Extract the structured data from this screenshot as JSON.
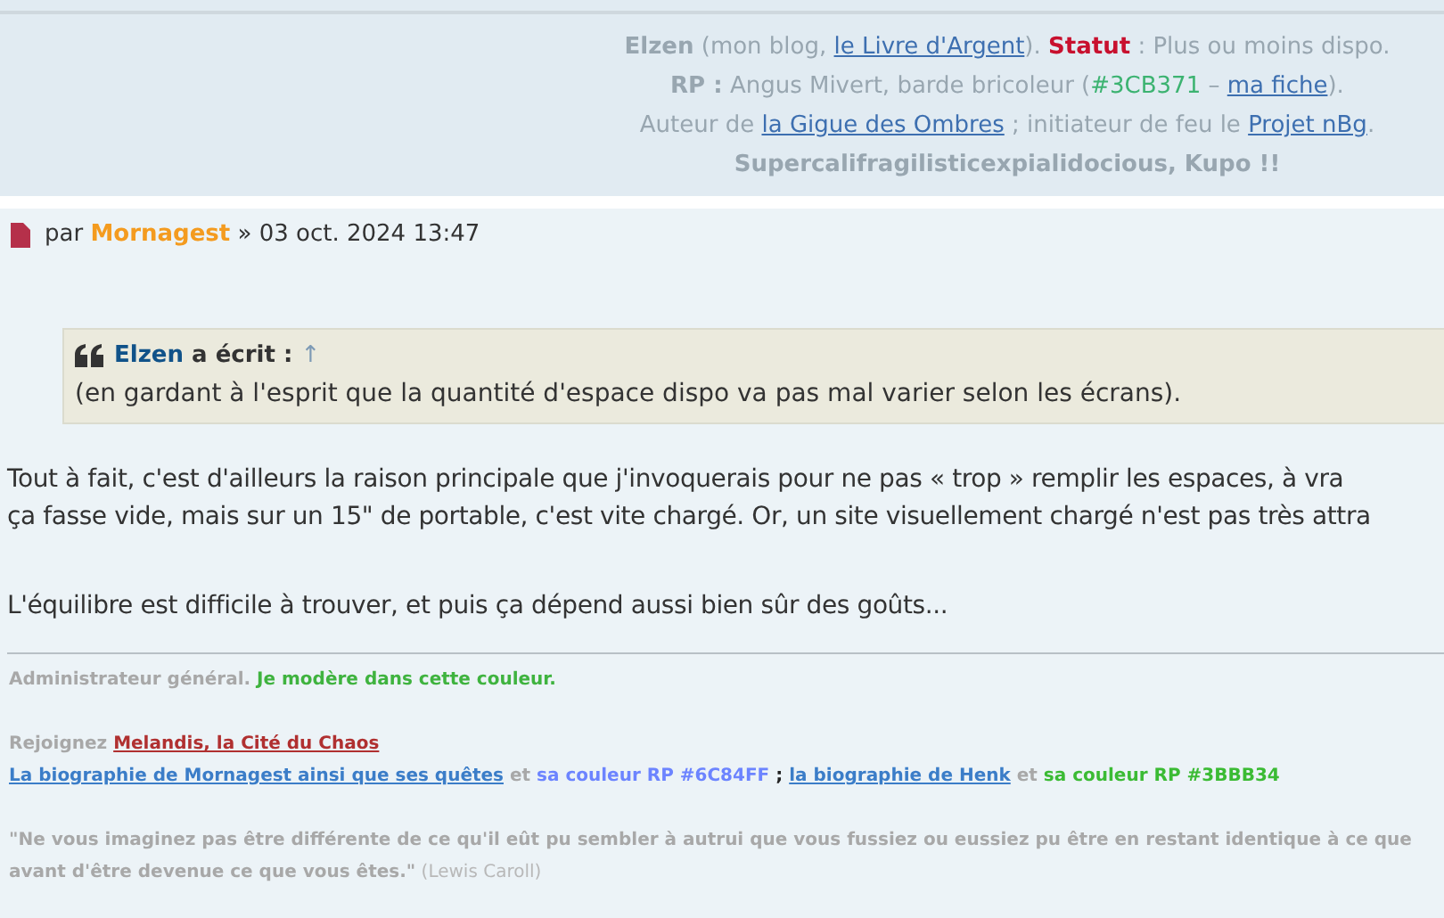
{
  "header_signature": {
    "lines": [
      [
        {
          "kind": "bold",
          "text": "Elzen"
        },
        {
          "kind": "plain",
          "text": " (mon blog, "
        },
        {
          "kind": "link",
          "text": "le Livre d'Argent"
        },
        {
          "kind": "plain",
          "text": "). "
        },
        {
          "kind": "status",
          "text": "Statut"
        },
        {
          "kind": "plain",
          "text": " : Plus ou moins dispo."
        }
      ],
      [
        {
          "kind": "bold",
          "text": "RP :"
        },
        {
          "kind": "plain",
          "text": " Angus Mivert, barde bricoleur ("
        },
        {
          "kind": "colored",
          "text": "#3CB371",
          "color": "#3cb371"
        },
        {
          "kind": "plain",
          "text": " – "
        },
        {
          "kind": "link",
          "text": "ma fiche"
        },
        {
          "kind": "plain",
          "text": ")."
        }
      ],
      [
        {
          "kind": "plain",
          "text": "Auteur de "
        },
        {
          "kind": "link",
          "text": "la Gigue des Ombres"
        },
        {
          "kind": "plain",
          "text": " ; initiateur de feu le "
        },
        {
          "kind": "link",
          "text": "Projet nBg"
        },
        {
          "kind": "plain",
          "text": "."
        }
      ],
      [
        {
          "kind": "bold",
          "text": "Supercalifragilisticexpialidocious, Kupo !!"
        }
      ]
    ]
  },
  "post": {
    "by": "par",
    "author": "Mornagest",
    "date": "» 03 oct. 2024 13:47",
    "quote": {
      "author": "Elzen",
      "wrote": "a écrit :",
      "arrow": "↑",
      "text": "(en gardant à l'esprit que la quantité d'espace dispo va pas mal varier selon les écrans)."
    },
    "paragraphs": [
      [
        "Tout à fait, c'est d'ailleurs la raison principale que j'invoquerais pour ne pas « trop » remplir les espaces, à vra",
        "ça fasse vide, mais sur un 15\" de portable, c'est vite chargé. Or, un site visuellement chargé n'est pas très attra"
      ],
      [
        "L'équilibre est difficile à trouver, et puis ça dépend aussi bien sûr des goûts..."
      ]
    ]
  },
  "signature": {
    "blocks": [
      [
        [
          {
            "kind": "plain",
            "text": "Administrateur général."
          },
          {
            "kind": "colored",
            "text": " Je modère dans cette couleur.",
            "color": "#3fb33f"
          }
        ]
      ],
      [
        [
          {
            "kind": "plain",
            "text": "Rejoignez "
          },
          {
            "kind": "link",
            "text": "Melandis, la Cité du Chaos",
            "color": "#b03030"
          }
        ],
        [
          {
            "kind": "link",
            "text": "La biographie de Mornagest ainsi que ses quêtes",
            "color": "#3b7dc8"
          },
          {
            "kind": "plain",
            "text": " et "
          },
          {
            "kind": "colored",
            "text": "sa couleur RP #6C84FF",
            "color": "#6c84ff"
          },
          {
            "kind": "dark",
            "text": " ; "
          },
          {
            "kind": "link",
            "text": "la biographie de Henk",
            "color": "#3b7dc8"
          },
          {
            "kind": "plain",
            "text": " et "
          },
          {
            "kind": "colored",
            "text": "sa couleur RP #3BBB34",
            "color": "#3bbb34"
          }
        ]
      ],
      [
        [
          {
            "kind": "plain",
            "text": "\"Ne vous imaginez pas être différente de ce qu'il eût pu sembler à autrui que vous fussiez ou eussiez pu être en restant identique à ce que"
          }
        ],
        [
          {
            "kind": "plain",
            "text": "avant d'être devenue ce que vous êtes.\""
          },
          {
            "kind": "light",
            "text": " (Lewis Caroll)"
          }
        ]
      ]
    ]
  }
}
